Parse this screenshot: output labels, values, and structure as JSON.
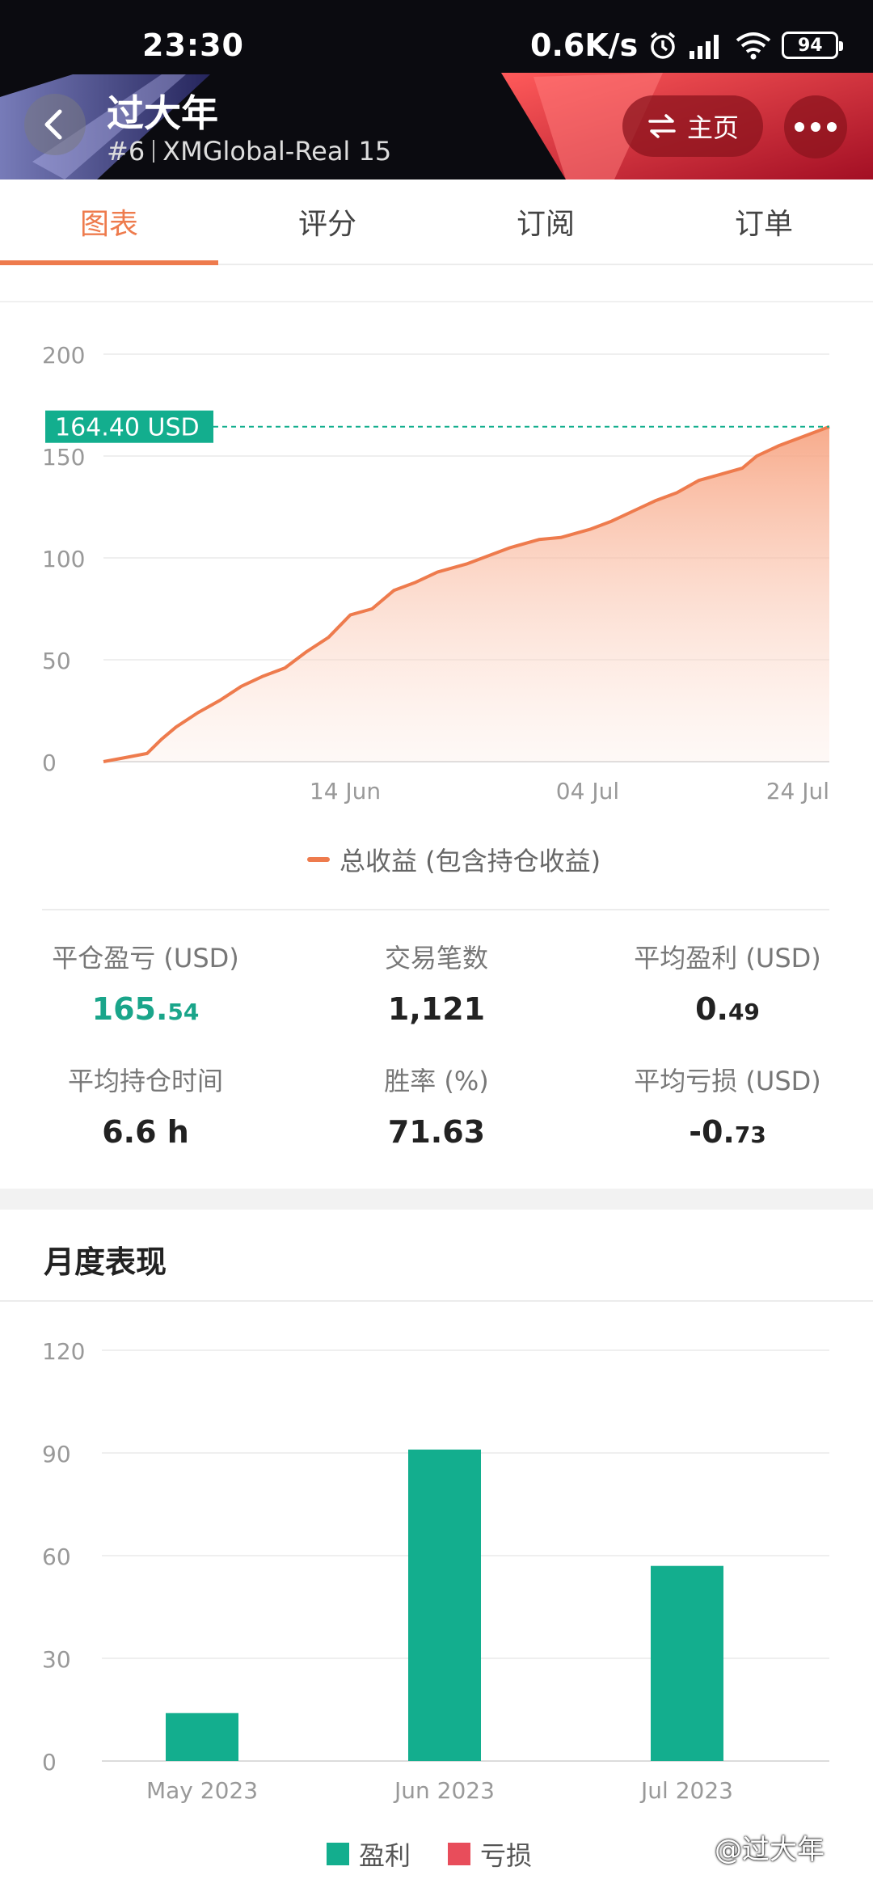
{
  "status_bar": {
    "time": "23:30",
    "speed": "0.6K/s",
    "battery": "94"
  },
  "header": {
    "title": "过大年",
    "rank": "#6",
    "account": "XMGlobal-Real 15",
    "home_label": "主页",
    "icons": {
      "back": "chevron-left-icon",
      "switch": "swap-arrows-icon",
      "more": "more-dots-icon"
    }
  },
  "tabs": [
    {
      "label": "图表",
      "active": true
    },
    {
      "label": "评分",
      "active": false
    },
    {
      "label": "订阅",
      "active": false
    },
    {
      "label": "订单",
      "active": false
    }
  ],
  "growth": {
    "current_value_label": "164.40 USD",
    "legend": "总收益 (包含持仓收益)"
  },
  "stats": {
    "closed_pl": {
      "label": "平仓盈亏 (USD)",
      "int": "165.",
      "dec": "54"
    },
    "trades": {
      "label": "交易笔数",
      "value": "1,121"
    },
    "avg_profit": {
      "label": "平均盈利 (USD)",
      "int": "0.",
      "dec": "49"
    },
    "avg_hold": {
      "label": "平均持仓时间",
      "value": "6.6 h"
    },
    "win_rate": {
      "label": "胜率 (%)",
      "value": "71.63"
    },
    "avg_loss": {
      "label": "平均亏损 (USD)",
      "int": "-0.",
      "dec": "73"
    }
  },
  "monthly": {
    "title": "月度表现",
    "legend_profit": "盈利",
    "legend_loss": "亏损"
  },
  "watermark": "@过大年",
  "colors": {
    "accent": "#ee7b4d",
    "profit": "#13ae8e",
    "loss": "#e84d5b",
    "price_tag": "#13ae8e"
  },
  "chart_data": [
    {
      "type": "area",
      "title": "",
      "ylim": [
        0,
        200
      ],
      "yticks": [
        0,
        50,
        100,
        150,
        200
      ],
      "xtick_labels": [
        "14 Jun",
        "04 Jul",
        "24 Jul"
      ],
      "xtick_positions": [
        0.333,
        0.667,
        1.0
      ],
      "series": [
        {
          "name": "总收益 (包含持仓收益)",
          "x": [
            0,
            0.03,
            0.06,
            0.08,
            0.1,
            0.13,
            0.16,
            0.19,
            0.22,
            0.25,
            0.28,
            0.31,
            0.34,
            0.37,
            0.4,
            0.43,
            0.46,
            0.5,
            0.53,
            0.56,
            0.6,
            0.63,
            0.67,
            0.7,
            0.73,
            0.76,
            0.79,
            0.82,
            0.85,
            0.88,
            0.9,
            0.93,
            0.96,
            1.0
          ],
          "values": [
            0,
            2,
            4,
            11,
            17,
            24,
            30,
            37,
            42,
            46,
            54,
            61,
            72,
            75,
            84,
            88,
            93,
            97,
            101,
            105,
            109,
            110,
            114,
            118,
            123,
            128,
            132,
            138,
            141,
            144,
            150,
            155,
            159,
            164.4
          ]
        }
      ],
      "reference_line": 164.4,
      "legend": "bottom"
    },
    {
      "type": "bar",
      "title": "月度表现",
      "categories": [
        "May 2023",
        "Jun 2023",
        "Jul 2023"
      ],
      "ylim": [
        0,
        120
      ],
      "yticks": [
        0,
        30,
        60,
        90,
        120
      ],
      "series": [
        {
          "name": "盈利",
          "values": [
            14,
            91,
            57
          ]
        },
        {
          "name": "亏损",
          "values": [
            0,
            0,
            0
          ]
        }
      ],
      "legend": "bottom"
    }
  ]
}
